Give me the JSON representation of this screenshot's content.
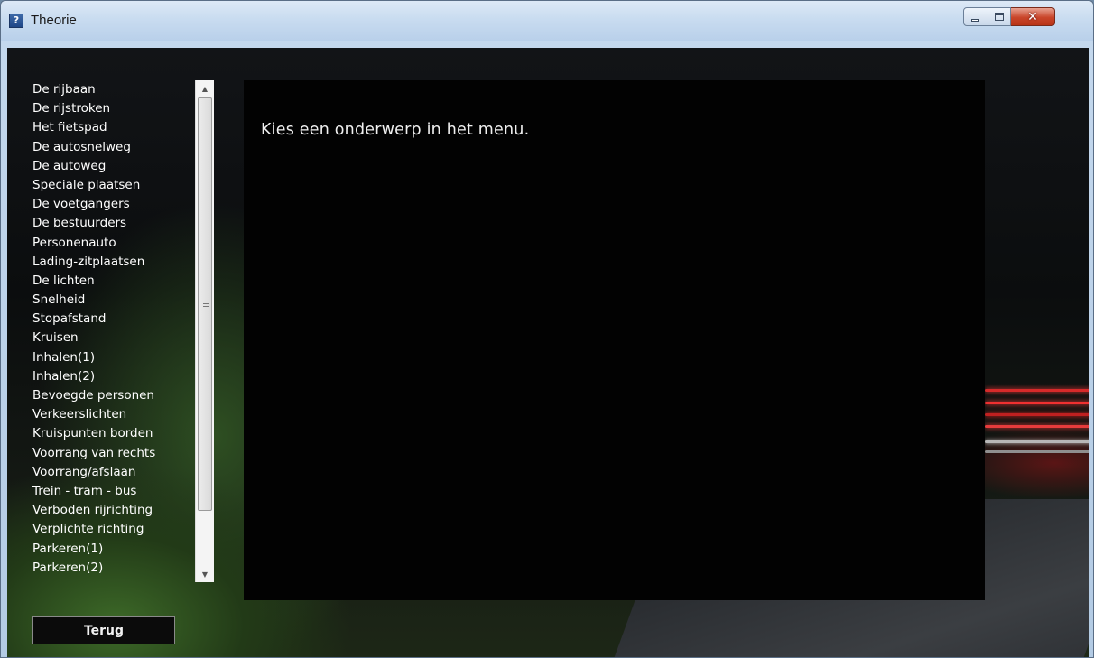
{
  "window": {
    "title": "Theorie",
    "app_icon_glyph": "?",
    "app_icon": "help-icon"
  },
  "menu": {
    "items": [
      "De rijbaan",
      "De rijstroken",
      "Het fietspad",
      "De autosnelweg",
      "De autoweg",
      "Speciale plaatsen",
      "De voetgangers",
      "De bestuurders",
      "Personenauto",
      "Lading-zitplaatsen",
      "De lichten",
      "Snelheid",
      "Stopafstand",
      "Kruisen",
      "Inhalen(1)",
      "Inhalen(2)",
      "Bevoegde personen",
      "Verkeerslichten",
      "Kruispunten borden",
      "Voorrang van rechts",
      "Voorrang/afslaan",
      "Trein - tram - bus",
      "Verboden rijrichting",
      "Verplichte richting",
      "Parkeren(1)",
      "Parkeren(2)"
    ]
  },
  "content": {
    "message": "Kies een onderwerp in het menu."
  },
  "buttons": {
    "back_label": "Terug"
  },
  "colors": {
    "panel_background": "#020202",
    "text": "#ffffff",
    "close_button": "#c9452a"
  }
}
